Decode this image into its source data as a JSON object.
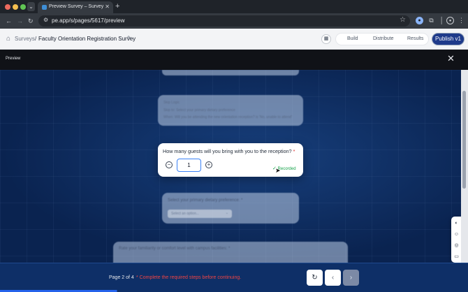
{
  "browser": {
    "tab_title": "Preview Survey – Survey Eve",
    "tab_close": "✕",
    "new_tab": "+",
    "url": "pe.app/s/pages/5617/preview"
  },
  "header": {
    "breadcrumb_root": "Surveys",
    "breadcrumb_sep": "/",
    "survey_title": "Faculty Orientation Registration Survey",
    "nav": {
      "build": "Build",
      "distribute": "Distribute",
      "results": "Results"
    },
    "publish_label": "Publish v1"
  },
  "preview": {
    "label": "Preview",
    "close_glyph": "✕"
  },
  "blurred": {
    "skip_title": "Skip Logic",
    "skip_line1": "Skip to: Select your primary dietary preference",
    "skip_line2": "When: Will you be attending the new orientation reception? is 'No, unable to attend'",
    "diet_question": "Select your primary dietary preference: *",
    "diet_placeholder": "Select an option...",
    "rate_question": "Rate your familiarity or comfort level with campus facilities: *"
  },
  "question": {
    "text": "How many guests will you bring with you to the reception?",
    "required_mark": "*",
    "value": "1",
    "minus_glyph": "−",
    "plus_glyph": "+",
    "recorded_label": "Recorded",
    "recorded_check": "✓"
  },
  "footer": {
    "page_indicator": "Page 2 of 4",
    "warning": "* Complete the required steps before continuing.",
    "reset_glyph": "↻",
    "prev_glyph": "‹",
    "next_glyph": "›"
  },
  "icons": {
    "home": "home-icon",
    "edit": "pencil-icon",
    "side_toolbar": [
      "palette-icon",
      "users-icon",
      "compass-icon",
      "monitor-settings-icon"
    ]
  },
  "colors": {
    "accent": "#1e3a8a",
    "success": "#16a34a",
    "warning": "#ef4444",
    "canvas": "#0c2a5c"
  }
}
